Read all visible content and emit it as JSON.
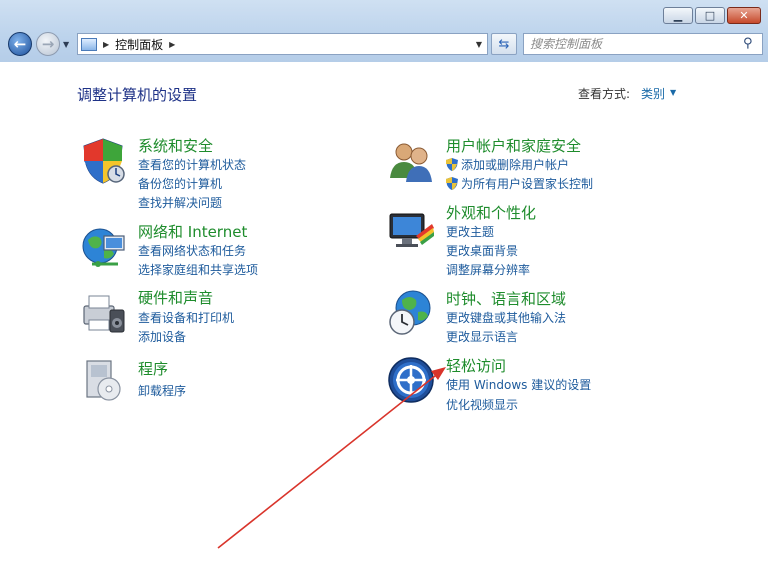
{
  "window": {
    "min": "▁",
    "max": "□",
    "close": "✕"
  },
  "address": {
    "path": "控制面板"
  },
  "search": {
    "placeholder": "搜索控制面板"
  },
  "page": {
    "title": "调整计算机的设置",
    "view_label": "查看方式:",
    "view_value": "类别"
  },
  "categories": [
    {
      "title": "系统和安全",
      "links": [
        "查看您的计算机状态",
        "备份您的计算机",
        "查找并解决问题"
      ]
    },
    {
      "title": "网络和 Internet",
      "links": [
        "查看网络状态和任务",
        "选择家庭组和共享选项"
      ]
    },
    {
      "title": "硬件和声音",
      "links": [
        "查看设备和打印机",
        "添加设备"
      ]
    },
    {
      "title": "程序",
      "links": [
        "卸载程序"
      ]
    },
    {
      "title": "用户帐户和家庭安全",
      "links": [
        "添加或删除用户帐户",
        "为所有用户设置家长控制"
      ]
    },
    {
      "title": "外观和个性化",
      "links": [
        "更改主题",
        "更改桌面背景",
        "调整屏幕分辨率"
      ]
    },
    {
      "title": "时钟、语言和区域",
      "links": [
        "更改键盘或其他输入法",
        "更改显示语言"
      ]
    },
    {
      "title": "轻松访问",
      "links": [
        "使用 Windows 建议的设置",
        "优化视频显示"
      ]
    }
  ],
  "colors": {
    "title_green": "#1e8c2c",
    "link_blue": "#1e5b9c",
    "annotation_red": "#d9342b"
  }
}
